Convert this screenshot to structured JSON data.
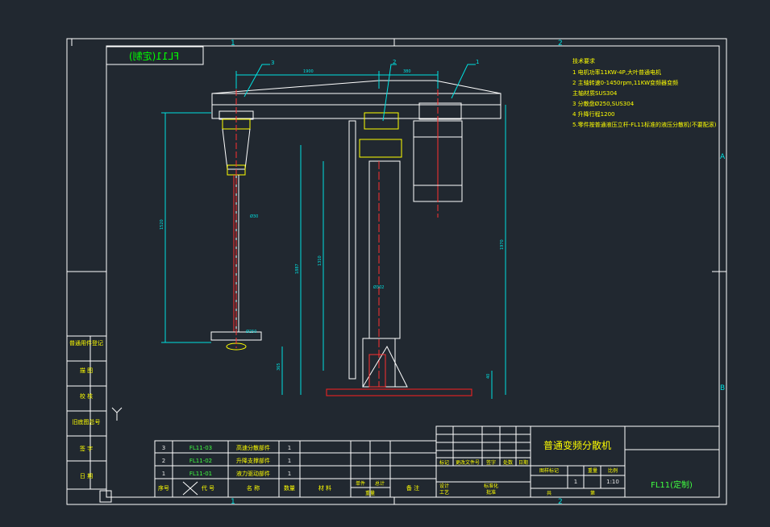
{
  "colors": {
    "background": "#212830",
    "frame": "#ffffff",
    "dimension": "#00e0e0",
    "machine": "#ffffff",
    "notes": "#ffff00",
    "text_white": "#e8e8e8",
    "green": "#40ff40",
    "red_base": "#ff2020",
    "center_line": "#ff3030"
  },
  "drawing": {
    "stamp_mirrored": "FL11(定制)",
    "zone_cols": [
      "1",
      "2"
    ],
    "zone_rows": [
      "A",
      "B"
    ],
    "callouts": [
      "3",
      "2",
      "1"
    ],
    "dims": {
      "arm_left": "1900",
      "arm_right": "380",
      "left_height": "1520",
      "shaft_dia": "Ø30",
      "disc_dia": "Ø250",
      "col_height_1": "1887",
      "col_height_2": "1310",
      "col_dia": "Ø302",
      "base_gap": "365",
      "base_thk": "40",
      "total_height": "1970"
    }
  },
  "tech_notes": {
    "title": "技术要求",
    "items": [
      "1 电机功率11KW-4P,大叶普通电机",
      "2 主轴转速0-1450rpm,11KW变频器变频",
      "  主轴材质SUS304",
      "3 分散盘Ø250,SUS304",
      "4 升降行程1200",
      "5.零件按普通液压立杆-FL11标准的液压分散机(不要配滚)"
    ]
  },
  "side_table": [
    "普通用件登记",
    "描  图",
    "校  核",
    "旧底图总号",
    "签  字",
    "日  期"
  ],
  "parts_table": {
    "rows": [
      {
        "no": "3",
        "code": "FL11-03",
        "name": "高速分散部件",
        "qty": "1"
      },
      {
        "no": "2",
        "code": "FL11-02",
        "name": "升降支撑部件",
        "qty": "1"
      },
      {
        "no": "1",
        "code": "FL11-01",
        "name": "液力驱动部件",
        "qty": "1"
      }
    ],
    "header": {
      "no": "序号",
      "code": "代  号",
      "name": "名  称",
      "qty": "数量",
      "material": "材  料",
      "single": "单件",
      "total": "总计",
      "weight": "重量",
      "remark": "备  注"
    }
  },
  "title_block": {
    "title": "普通变频分散机",
    "code": "FL11(定制)",
    "scale": "1:10",
    "sheet": "1",
    "labels": {
      "mark": "标记",
      "count": "处数",
      "file": "更改文件号",
      "sign": "签字",
      "date": "日期",
      "design": "设计",
      "standard": "标准化",
      "drawing_mark": "图样标记",
      "weight": "重量",
      "ratio": "比例",
      "check": "审核",
      "craft": "工艺",
      "approve": "批准",
      "page": "共",
      "page2": "第"
    }
  }
}
